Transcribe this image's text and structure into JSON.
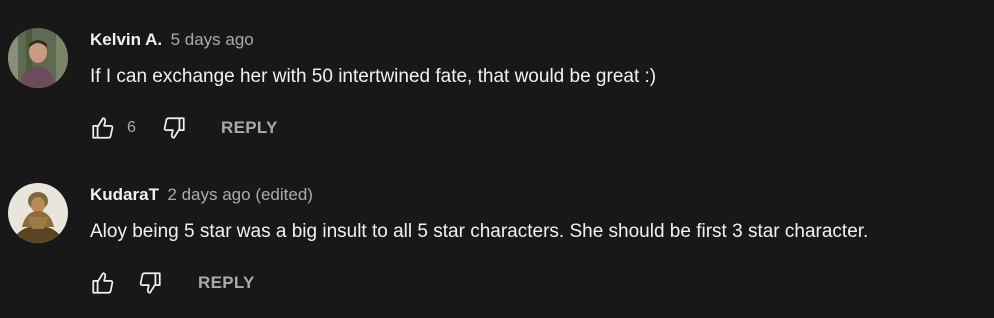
{
  "comments": [
    {
      "author": "Kelvin A.",
      "meta": "5 days ago",
      "text": "If I can exchange her with 50 intertwined fate, that would be great :)",
      "like_count": "6",
      "reply_label": "REPLY"
    },
    {
      "author": "KudaraT",
      "meta": "2 days ago (edited)",
      "text": "Aloy being 5 star was a big insult to all 5 star characters. She should be first 3 star character.",
      "like_count": "",
      "reply_label": "REPLY"
    }
  ],
  "icons": {
    "like": "thumbs-up-icon",
    "dislike": "thumbs-down-icon"
  },
  "colors": {
    "background": "#181818",
    "primary_text": "#f1f1f1",
    "secondary_text": "#aaaaaa"
  }
}
